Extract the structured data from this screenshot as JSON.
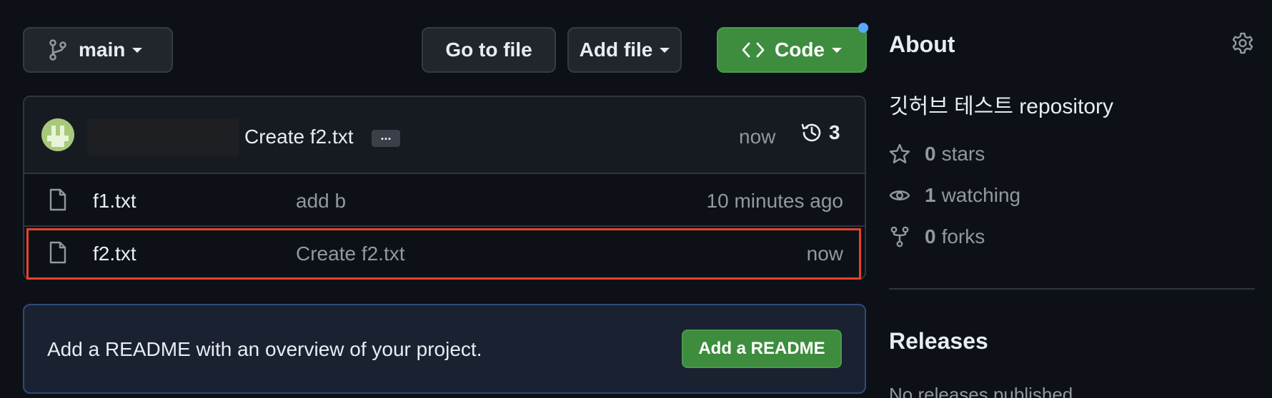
{
  "toolbar": {
    "branch_label": "main",
    "goto_label": "Go to file",
    "addfile_label": "Add file",
    "code_label": "Code"
  },
  "latest_commit": {
    "message": "Create f2.txt",
    "ellipsis": "...",
    "time": "now",
    "history_count": "3"
  },
  "files": [
    {
      "name": "f1.txt",
      "message": "add b",
      "time": "10 minutes ago"
    },
    {
      "name": "f2.txt",
      "message": "Create f2.txt",
      "time": "now"
    }
  ],
  "readme": {
    "text": "Add a README with an overview of your project.",
    "button_label": "Add a README"
  },
  "about": {
    "title": "About",
    "description": "깃허브 테스트 repository",
    "stars_count": "0",
    "stars_label": "stars",
    "watching_count": "1",
    "watching_label": "watching",
    "forks_count": "0",
    "forks_label": "forks"
  },
  "releases": {
    "title": "Releases",
    "empty_text": "No releases published"
  },
  "colors": {
    "accent_green": "#3e8d3f",
    "highlight_red": "#e8422b",
    "notification_blue": "#58a6ff"
  }
}
